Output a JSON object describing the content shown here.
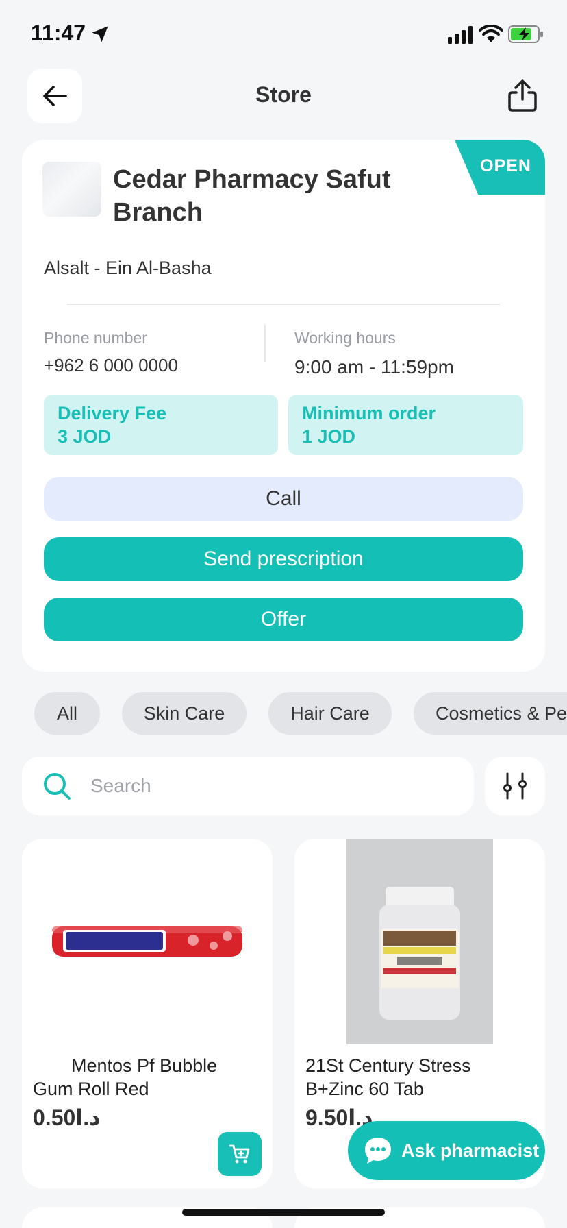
{
  "status_bar": {
    "time": "11:47"
  },
  "header": {
    "title": "Store"
  },
  "store": {
    "status_badge": "OPEN",
    "name": "Cedar Pharmacy Safut Branch",
    "location": "Alsalt - Ein Al-Basha",
    "phone_label": "Phone number",
    "phone_value": "+962 6 000 0000",
    "hours_label": "Working hours",
    "hours_value": "9:00 am - 11:59pm",
    "delivery_fee_label": "Delivery Fee",
    "delivery_fee_value": "3 JOD",
    "min_order_label": "Minimum order",
    "min_order_value": "1 JOD",
    "call_label": "Call",
    "prescription_label": "Send prescription",
    "offer_label": "Offer"
  },
  "categories": [
    "All",
    "Skin Care",
    "Hair Care",
    "Cosmetics & Pe"
  ],
  "search": {
    "placeholder": "Search"
  },
  "products": [
    {
      "name": "Mentos Pf Bubble Gum Roll Red",
      "currency": "د.ا",
      "price": "0.50"
    },
    {
      "name": "21St Century Stress B+Zinc 60 Tab",
      "currency": "د.ا",
      "price": "9.50"
    }
  ],
  "fab": {
    "label": "Ask pharmacist"
  },
  "colors": {
    "accent": "#17bfb6",
    "call_bg": "#e3ebfc",
    "fee_bg": "#d1f3f1",
    "background": "#f5f6f8"
  }
}
